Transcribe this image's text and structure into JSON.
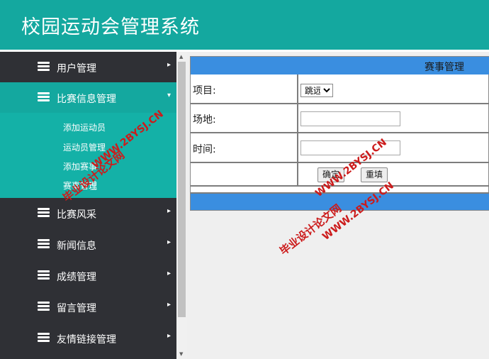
{
  "app": {
    "title": "校园运动会管理系统"
  },
  "sidebar": {
    "items": [
      {
        "label": "用户管理",
        "arrow": "▸"
      },
      {
        "label": "比赛信息管理",
        "arrow": "▾"
      },
      {
        "label": "比赛风采",
        "arrow": "▸"
      },
      {
        "label": "新闻信息",
        "arrow": "▸"
      },
      {
        "label": "成绩管理",
        "arrow": "▸"
      },
      {
        "label": "留言管理",
        "arrow": "▸"
      },
      {
        "label": "友情链接管理",
        "arrow": "▸"
      }
    ],
    "subitems": [
      "添加运动员",
      "运动员管理",
      "添加赛事",
      "赛事管理"
    ]
  },
  "form": {
    "title": "赛事管理",
    "item_label": "项目:",
    "item_value": "跳远",
    "venue_label": "场地:",
    "venue_value": "",
    "time_label": "时间:",
    "time_value": "",
    "confirm_label": "确定",
    "reset_label": "重填"
  },
  "watermark": {
    "site": "WWW.2BYSJ.CN",
    "name": "毕业设计论文网"
  },
  "colors": {
    "header": "#14a89f",
    "sidebar": "#2f3035",
    "active": "#14a89f",
    "panel_bar": "#3a8ee0",
    "watermark": "#cc1b1b"
  }
}
